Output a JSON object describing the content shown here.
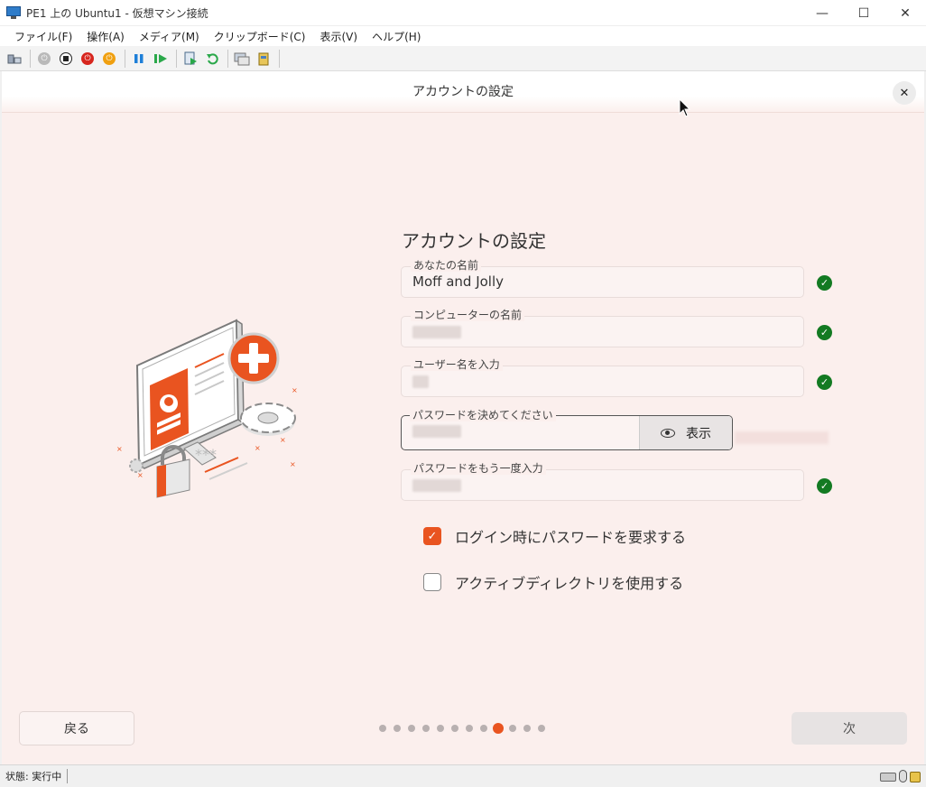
{
  "window": {
    "title": "PE1 上の Ubuntu1  - 仮想マシン接続",
    "minimize": "—",
    "maximize": "☐",
    "close": "✕"
  },
  "menu": [
    "ファイル(F)",
    "操作(A)",
    "メディア(M)",
    "クリップボード(C)",
    "表示(V)",
    "ヘルプ(H)"
  ],
  "toolbar": {
    "icons": [
      "ctrl-alt-del-icon",
      "start-icon",
      "turn-off-icon",
      "shutdown-icon",
      "power-icon",
      "pause-icon",
      "resume-icon",
      "checkpoint-icon",
      "revert-icon",
      "enhanced-session-icon",
      "share-icon"
    ]
  },
  "header": {
    "title": "アカウントの設定",
    "close": "✕"
  },
  "form": {
    "title": "アカウントの設定",
    "name_label": "あなたの名前",
    "name_value": "Moff and Jolly",
    "computer_label": "コンピューターの名前",
    "username_label": "ユーザー名を入力",
    "password_label": "パスワードを決めてください",
    "show_label": "表示",
    "confirm_label": "パスワードをもう一度入力",
    "check_mark": "✓"
  },
  "options": {
    "require_password": "ログイン時にパスワードを要求する",
    "require_password_checked": true,
    "active_directory": "アクティブディレクトリを使用する",
    "active_directory_checked": false
  },
  "nav": {
    "back": "戻る",
    "next": "次",
    "step_count": 12,
    "current_step": 9
  },
  "status": {
    "text": "状態: 実行中"
  },
  "colors": {
    "accent": "#e95420",
    "success": "#137a22",
    "background": "#fbefed"
  }
}
